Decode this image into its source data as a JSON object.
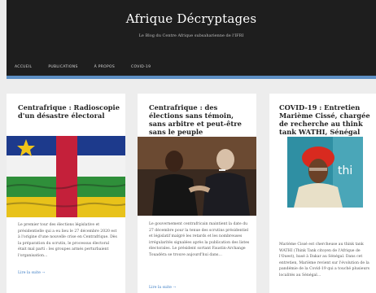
{
  "header": {
    "site_title": "Afrique Décryptages",
    "tagline": "Le Blog du Centre Afrique subsaharienne de l'IFRI",
    "nav": [
      "ACCUEIL",
      "PUBLICATIONS",
      "À PROPOS",
      "COVID-19"
    ]
  },
  "articles": [
    {
      "title": "Centrafrique : Radioscopie d'un désastre électoral",
      "image": "central-african-flag",
      "excerpt": "Le premier tour des élections législative et présidentielle qui a eu lieu le 27 décembre 2020 est à l'origine d'une nouvelle crise en Centrafrique. Dès la préparation du scrutin, le processus électoral était mal parti : les groupes armés perturbaient l'organisation…",
      "read_more": "Lire la suite →"
    },
    {
      "title": "Centrafrique : des élections sans témoin, sans arbitre et peut-être sans le peuple",
      "image": "two-men-shaking-hands",
      "excerpt": "Le gouvernement centrafricain maintient la date du 27 décembre pour la tenue des scrutins présidentiel et législatif malgré les retards et les nombreuses irrégularités signalées après la publication des listes électorales. Le président sortant Faustin-Archange Touadéra se trouve aujourd'hui dans…",
      "read_more": "Lire la suite →"
    },
    {
      "title": "COVID-19 : Entretien Marième Cissé, chargée de recherche au think tank WATHI, Sénégal",
      "image": "woman-red-headwrap",
      "excerpt": "Marième Cissé est chercheuse au think tank WATHI (Think Tank citoyen de l'Afrique de l'Ouest), basé à Dakar au Sénégal. Dans cet entretien, Marième revient sur l'évolution de la pandémie de la Covid-19 qui a touché plusieurs localités au Sénégal…",
      "read_more": ""
    }
  ],
  "image_texts": {
    "wathi_logo": "thi"
  },
  "colors": {
    "header_bg": "#1e1e1e",
    "accent_blue": "#5d8fc4",
    "link": "#3a7cc4",
    "page_bg": "#ededed"
  }
}
